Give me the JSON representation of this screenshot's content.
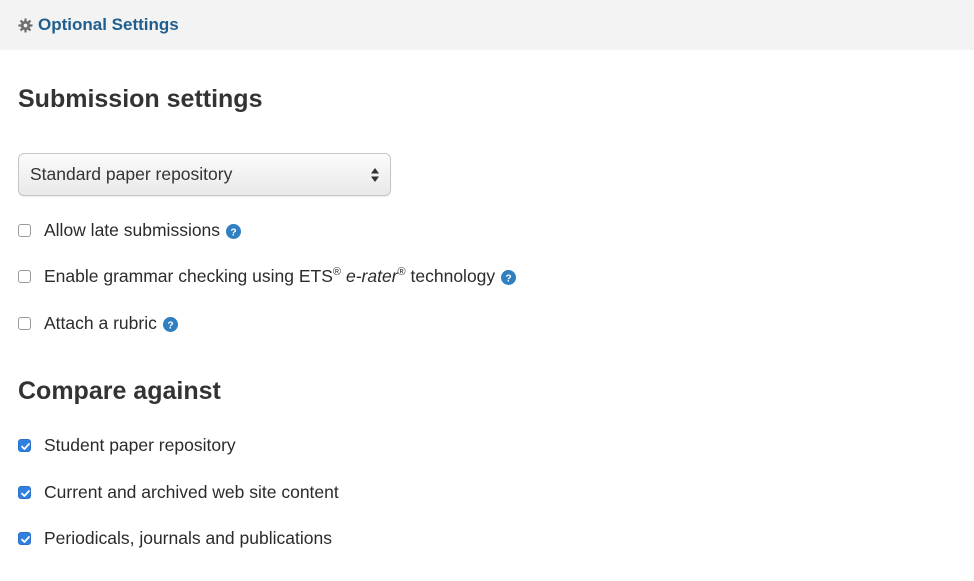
{
  "header": {
    "title": "Optional Settings",
    "icon": "gear-icon"
  },
  "submission": {
    "title": "Submission settings",
    "repository_select": {
      "selected": "Standard paper repository"
    },
    "options": [
      {
        "label": "Allow late submissions",
        "checked": false,
        "help": true
      },
      {
        "label_prefix": "Enable grammar checking using ETS",
        "reg1": "®",
        "label_italic": "e-rater",
        "reg2": "®",
        "label_suffix": " technology",
        "checked": false,
        "help": true
      },
      {
        "label": "Attach a rubric",
        "checked": false,
        "help": true
      }
    ]
  },
  "compare": {
    "title": "Compare against",
    "options": [
      {
        "label": "Student paper repository",
        "checked": true
      },
      {
        "label": "Current and archived web site content",
        "checked": true
      },
      {
        "label": "Periodicals, journals and publications",
        "checked": true
      }
    ]
  },
  "colors": {
    "header_bg": "#f3f3f3",
    "link": "#1f5e8e",
    "help_icon": "#2f7fc1",
    "checkbox_checked": "#2f80e0"
  }
}
